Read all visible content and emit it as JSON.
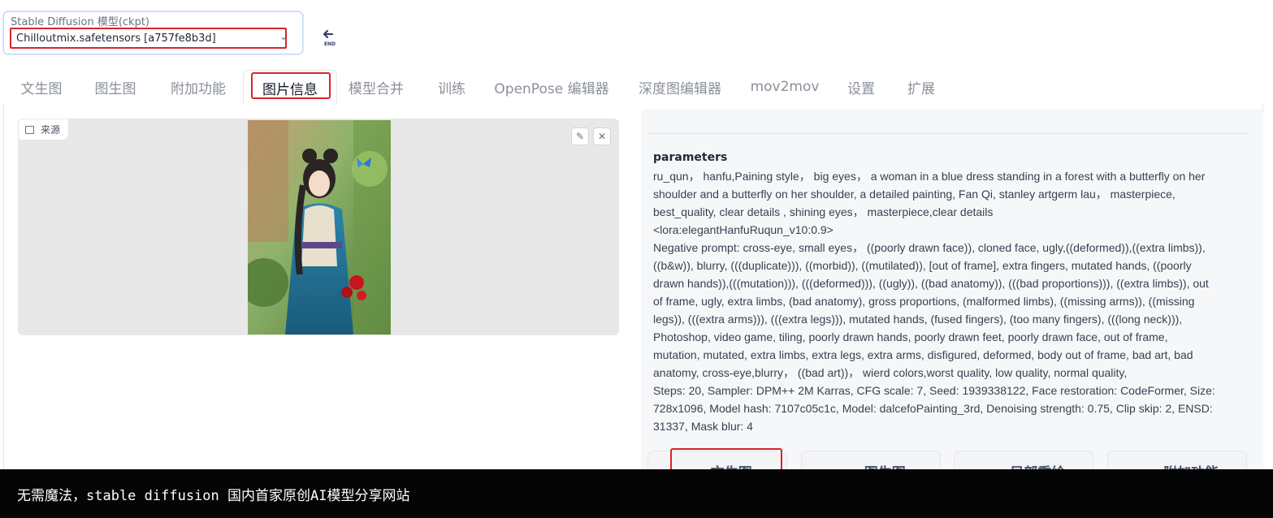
{
  "model": {
    "label": "Stable Diffusion 模型(ckpt)",
    "selected": "Chilloutmix.safetensors [a757fe8b3d]",
    "refresh_icon": "refresh-icon",
    "refresh_caption": "END"
  },
  "tabs": [
    {
      "label": "文生图"
    },
    {
      "label": "图生图"
    },
    {
      "label": "附加功能"
    },
    {
      "label": "图片信息",
      "active": true
    },
    {
      "label": "模型合并"
    },
    {
      "label": "训练"
    },
    {
      "label": "OpenPose 编辑器"
    },
    {
      "label": "深度图编辑器"
    },
    {
      "label": "mov2mov"
    },
    {
      "label": "设置"
    },
    {
      "label": "扩展"
    }
  ],
  "image_panel": {
    "source_label": "来源",
    "source_icon": "image-icon",
    "edit_icon": "pencil-icon",
    "close_icon": "close-icon"
  },
  "info": {
    "title": "parameters",
    "lines": [
      "ru_qun， hanfu,Paining style， big eyes， a woman in a blue dress standing in a forest with a butterfly on her",
      "shoulder and a butterfly on her shoulder, a detailed painting, Fan Qi, stanley artgerm lau， masterpiece,",
      "best_quality, clear details , shining eyes， masterpiece,clear details",
      "<lora:elegantHanfuRuqun_v10:0.9>",
      "Negative prompt: cross-eye, small eyes， ((poorly drawn face)), cloned face, ugly,((deformed)),((extra limbs)),",
      "((b&w)), blurry, (((duplicate))), ((morbid)), ((mutilated)), [out of frame], extra fingers, mutated hands, ((poorly",
      "drawn hands)),(((mutation))), (((deformed))), ((ugly)), ((bad anatomy)), (((bad proportions))), ((extra limbs)), out",
      "of frame, ugly, extra limbs, (bad anatomy), gross proportions, (malformed limbs), ((missing arms)), ((missing",
      "legs)), (((extra arms))), (((extra legs))), mutated hands, (fused fingers), (too many fingers), (((long neck))),",
      "Photoshop, video game, tiling, poorly drawn hands, poorly drawn feet, poorly drawn face, out of frame,",
      "mutation, mutated, extra limbs, extra legs, extra arms, disfigured, deformed, body out of frame, bad art, bad",
      "anatomy, cross-eye,blurry， ((bad art))， wierd colors,worst quality, low quality, normal quality,",
      "Steps: 20, Sampler: DPM++ 2M Karras, CFG scale: 7, Seed: 1939338122, Face restoration: CodeFormer, Size:",
      "728x1096, Model hash: 7107c05c1c, Model: dalcefoPainting_3rd, Denoising strength: 0.75, Clip skip: 2, ENSD:",
      "31337, Mask blur: 4"
    ]
  },
  "send_buttons": [
    {
      "label": ">> 文生图"
    },
    {
      "label": ">> 图生图"
    },
    {
      "label": ">> 局部重绘"
    },
    {
      "label": ">> 附加功能"
    }
  ],
  "caption": "无需魔法，stable diffusion 国内首家原创AI模型分享网站",
  "colors": {
    "highlight": "#d9252a",
    "dress_blue": "#1e6f8f"
  }
}
